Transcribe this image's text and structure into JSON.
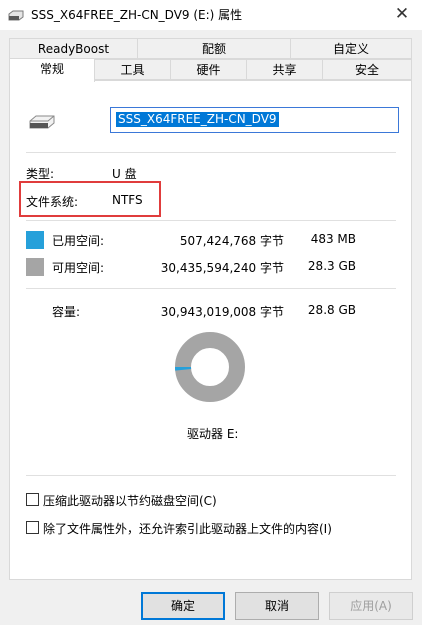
{
  "window": {
    "title": "SSS_X64FREE_ZH-CN_DV9 (E:) 属性",
    "close_glyph": "✕"
  },
  "tabs_top": [
    "ReadyBoost",
    "配额",
    "自定义"
  ],
  "tabs_bottom": [
    "常规",
    "工具",
    "硬件",
    "共享",
    "安全"
  ],
  "active_tab": "常规",
  "drive_name_value": "SSS_X64FREE_ZH-CN_DV9",
  "info": {
    "type_label": "类型:",
    "type_value": "U 盘",
    "fs_label": "文件系统:",
    "fs_value": "NTFS"
  },
  "space": {
    "used": {
      "label": "已用空间:",
      "bytes": "507,424,768 字节",
      "size": "483 MB",
      "color": "#26a0da"
    },
    "free": {
      "label": "可用空间:",
      "bytes": "30,435,594,240 字节",
      "size": "28.3 GB",
      "color": "#a5a5a5"
    },
    "capacity": {
      "label": "容量:",
      "bytes": "30,943,019,008 字节",
      "size": "28.8 GB"
    },
    "used_fraction": 0.0164
  },
  "drive_label": "驱动器 E:",
  "options": {
    "compress": "压缩此驱动器以节约磁盘空间(C)",
    "index": "除了文件属性外，还允许索引此驱动器上文件的内容(I)"
  },
  "buttons": {
    "ok": "确定",
    "cancel": "取消",
    "apply": "应用(A)"
  },
  "icons": {
    "drive": "usb-drive-icon",
    "close": "close-icon"
  }
}
